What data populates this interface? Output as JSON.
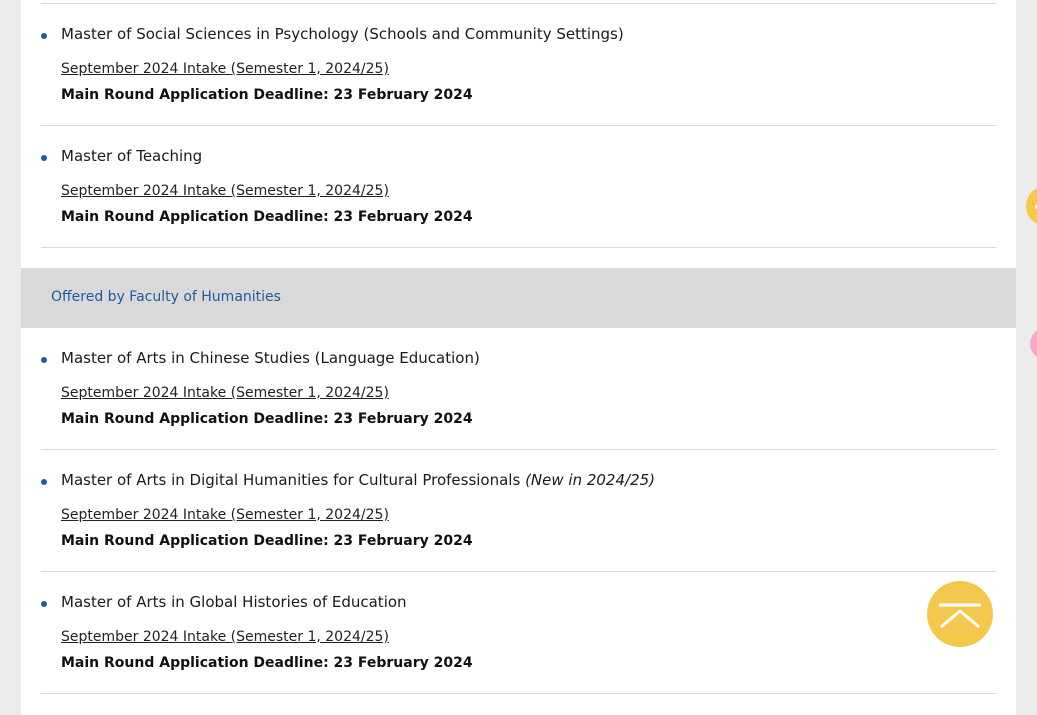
{
  "programs_top": [
    {
      "title": "Master of Social Sciences in Psychology (Schools and Community Settings)",
      "note": "",
      "intake": "September 2024 Intake (Semester 1, 2024/25)",
      "deadline": "Main Round Application Deadline: 23 February 2024"
    },
    {
      "title": "Master of Teaching",
      "note": "",
      "intake": "September 2024 Intake (Semester 1, 2024/25)",
      "deadline": "Main Round Application Deadline: 23 February 2024"
    }
  ],
  "section": {
    "heading": "Offered by Faculty of Humanities"
  },
  "programs_bottom": [
    {
      "title": "Master of Arts in Chinese Studies (Language Education)",
      "note": "",
      "intake": "September 2024 Intake (Semester 1, 2024/25)",
      "deadline": "Main Round Application Deadline: 23 February 2024"
    },
    {
      "title": "Master of Arts in Digital Humanities for Cultural Professionals",
      "note": "(New in 2024/25)",
      "intake": "September 2024 Intake (Semester 1, 2024/25)",
      "deadline": "Main Round Application Deadline: 23 February 2024"
    },
    {
      "title": "Master of Arts in Global Histories of Education",
      "note": "",
      "intake": "September 2024 Intake (Semester 1, 2024/25)",
      "deadline": "Main Round Application Deadline: 23 February 2024"
    }
  ],
  "widgets": {
    "back_to_top_icon": "chevron-up-icon",
    "side_tab_icon": "chevron-left-icon"
  },
  "colors": {
    "accent_blue": "#1f5a9c",
    "section_bg": "#d9d9d9",
    "back_to_top": "#f3c84d",
    "side_tab_pink": "#f5a9c6"
  }
}
